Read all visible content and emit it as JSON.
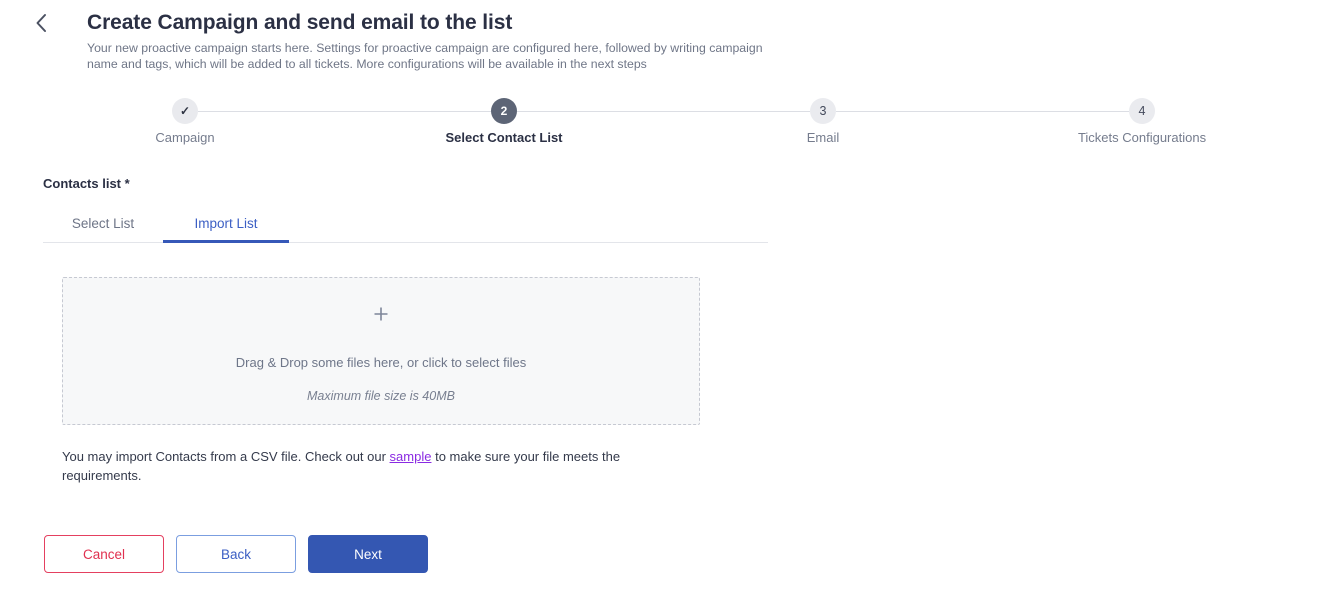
{
  "header": {
    "back_icon": "chevron-left-icon",
    "title": "Create Campaign and send email to the list",
    "subtitle": "Your new proactive campaign starts here. Settings for proactive campaign are configured here, followed by writing campaign name and tags, which will be added to all tickets. More configurations will be available in the next steps"
  },
  "stepper": {
    "steps": [
      {
        "indicator": "✓",
        "label": "Campaign",
        "state": "done"
      },
      {
        "indicator": "2",
        "label": "Select Contact List",
        "state": "active"
      },
      {
        "indicator": "3",
        "label": "Email",
        "state": "todo"
      },
      {
        "indicator": "4",
        "label": "Tickets Configurations",
        "state": "todo"
      }
    ]
  },
  "contacts": {
    "section_label": "Contacts list *",
    "tabs": [
      {
        "label": "Select List",
        "active": false
      },
      {
        "label": "Import List",
        "active": true
      }
    ],
    "dropzone": {
      "plus_icon": "plus-icon",
      "primary_text": "Drag & Drop some files here, or click to select files",
      "secondary_text": "Maximum file size is 40MB"
    },
    "help": {
      "before_link": "You may import Contacts from a CSV file. Check out our ",
      "link_text": "sample",
      "after_link": " to make sure your file meets the requirements."
    }
  },
  "footer": {
    "cancel_label": "Cancel",
    "back_label": "Back",
    "next_label": "Next"
  },
  "colors": {
    "primary_blue": "#3457b2",
    "tab_active_blue": "#3658b8",
    "cancel_red": "#e0304f",
    "link_purple": "#8a2be2",
    "step_active_slate": "#5d6576",
    "step_idle_gray": "#eaebef"
  }
}
